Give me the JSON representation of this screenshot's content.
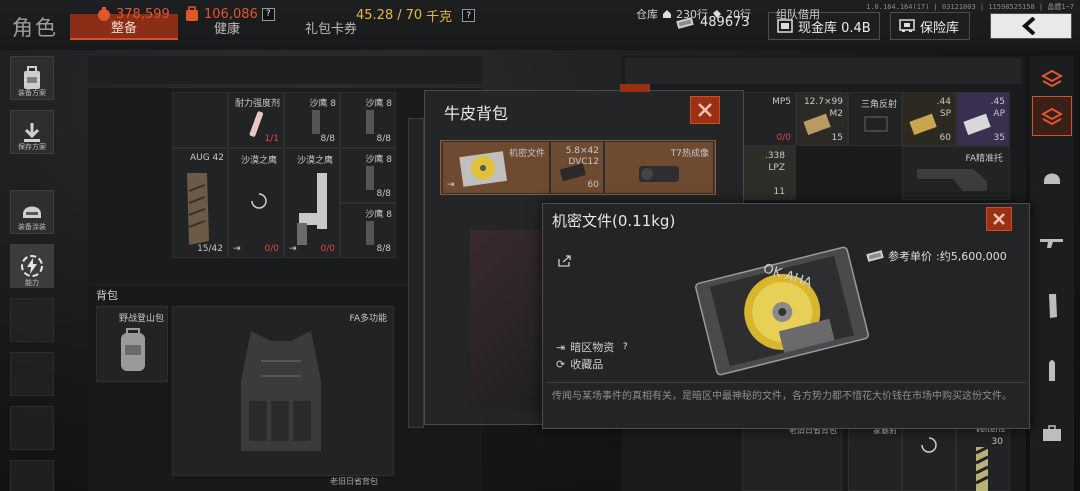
{
  "header": {
    "title": "角色",
    "tabs": [
      "整备",
      "健康",
      "礼包卡券"
    ],
    "version": "1.0.164.164(17) | 03121003 | 11598525158 | 晶體1~7",
    "money": "489673",
    "cash_vault_label": "现金库 0.4B",
    "vault_label": "保险库"
  },
  "left_rail": {
    "items": [
      "装备方案",
      "保存方案",
      "装备涂装",
      "能力"
    ]
  },
  "resources": {
    "orange_value": "378,599",
    "bag_value": "106,086",
    "weight_current": "45.28",
    "weight_sep": "/",
    "weight_max": "70",
    "weight_unit": "千克",
    "help": "?"
  },
  "inventory": {
    "cells": [
      {
        "name": "耐力强度剂",
        "count": "1/1"
      },
      {
        "name": "沙鹰 8",
        "count": "8/8"
      },
      {
        "name": "沙鹰 8",
        "count": "8/8"
      },
      {
        "name": "AUG 42",
        "count": "15/42"
      },
      {
        "name": "沙漠之鹰",
        "count": "0/0"
      },
      {
        "name": "沙漠之鹰",
        "count": "0/0"
      },
      {
        "name": "沙鹰 8",
        "count": "8/8"
      },
      {
        "name": "沙鹰 8",
        "count": "8/8"
      }
    ]
  },
  "backpack_section": {
    "label": "背包",
    "bag_name": "野战登山包",
    "vest_name": "FA多功能",
    "bottom_label": "老旧日省背包"
  },
  "right_panel": {
    "storage_label": "仓库",
    "storage_rows": "230行",
    "tag_rows": "20行",
    "team_tab": "组队借用",
    "items": [
      {
        "name": "MP5",
        "count": "0/0"
      },
      {
        "name": "12.7×99",
        "sub": "M2",
        "count": "15"
      },
      {
        "name": "三角反射",
        "count": ""
      },
      {
        "name": ".44",
        "sub": "SP",
        "count": "60"
      },
      {
        "name": ".45",
        "sub": "AP",
        "count": "35"
      },
      {
        "name": ".338",
        "sub": "LPZ",
        "count": "11"
      },
      {
        "name": "FA精准托",
        "count": ""
      },
      {
        "name": "老旧日省背包",
        "count": ""
      },
      {
        "name": "家暴射",
        "count": ""
      },
      {
        "name": "Velteris",
        "count": "30"
      }
    ]
  },
  "bp_window": {
    "title": "牛皮背包",
    "slots": [
      {
        "name": "机密文件",
        "count": ""
      },
      {
        "name": "5.8×42",
        "sub": "DVC12",
        "count": "60"
      },
      {
        "name": "T7热成像",
        "count": ""
      }
    ]
  },
  "detail": {
    "title": "机密文件(0.11kg)",
    "price_label": "参考单价",
    "price_value": ":约5,600,000",
    "tag1": "暗区物资",
    "tag2": "收藏品",
    "help": "?",
    "description": "传闻与某场事件的真相有关，是暗区中最神秘的文件，各方势力都不惜花大价钱在市场中购买这份文件。",
    "disk_text": "OK AHA"
  },
  "colors": {
    "accent": "#d0522c",
    "orange_text": "#e2562e",
    "weight_text": "#e9b83a",
    "tab_active_bg": "#8a2e18"
  }
}
